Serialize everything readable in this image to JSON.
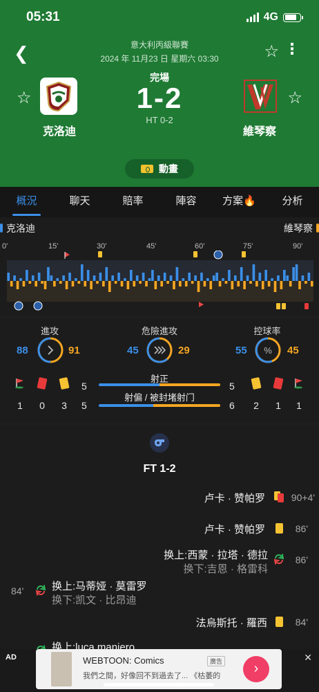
{
  "status_bar": {
    "time": "05:31",
    "network": "4G"
  },
  "match": {
    "league": "意大利丙級聯賽",
    "datetime": "2024 年 11月23 日 星期六 03:30",
    "status": "完場",
    "score": "1-2",
    "halftime": "HT 0-2",
    "home": {
      "name": "克洛迪"
    },
    "away": {
      "name": "維琴察"
    },
    "animation_label": "動畫"
  },
  "tabs": [
    {
      "label": "概況",
      "active": true
    },
    {
      "label": "聊天"
    },
    {
      "label": "賠率"
    },
    {
      "label": "陣容"
    },
    {
      "label": "方案🔥"
    },
    {
      "label": "分析"
    }
  ],
  "team_row": {
    "home": "克洛迪",
    "away": "維琴察"
  },
  "momentum": {
    "minutes": [
      "0'",
      "15'",
      "30'",
      "45'",
      "60'",
      "75'",
      "90'"
    ],
    "home_color": "#3b8fe8",
    "away_color": "#f5a623",
    "values": [
      3,
      -2,
      2,
      -3,
      1,
      -2,
      4,
      -1,
      2,
      -2,
      3,
      -1,
      -3,
      5,
      2,
      -2,
      1,
      -1,
      2,
      -3,
      3,
      -2,
      1,
      -1,
      6,
      -2,
      4,
      -3,
      2,
      -1,
      3,
      -2,
      5,
      -4,
      2,
      -1,
      3,
      -2,
      1,
      -3,
      4,
      -2,
      2,
      -1,
      3,
      -2,
      1,
      4,
      -3,
      2,
      -2,
      3,
      -1,
      2,
      -3,
      5,
      -2,
      1,
      -2,
      3,
      -1,
      2,
      -4,
      3,
      -2,
      1,
      -3,
      2,
      3,
      -2,
      1,
      -1,
      4,
      -3,
      2,
      -2,
      5,
      -3,
      2,
      -1,
      6,
      -2,
      3,
      -3,
      4,
      -2,
      1,
      -4,
      2,
      -3,
      4,
      2,
      -2,
      5,
      6,
      -3,
      2,
      -1,
      3,
      -2
    ]
  },
  "stats": {
    "attack": {
      "label": "進攻",
      "home": "88",
      "away": "91"
    },
    "dangerous": {
      "label": "危險進攻",
      "home": "45",
      "away": "29"
    },
    "possession": {
      "label": "控球率",
      "home": "55",
      "away": "45"
    },
    "home_counts": {
      "corners": "1",
      "red": "0",
      "yellow": "3",
      "on_target": "5",
      "off_target": "5"
    },
    "away_counts": {
      "corners": "1",
      "red": "1",
      "yellow": "2",
      "on_target": "5",
      "off_target": "6"
    },
    "on_target_label": "射正",
    "off_target_label": "射偏 / 被封堵射门"
  },
  "events": {
    "ft": "FT 1-2",
    "list": [
      {
        "name": "卢卡 · 赞帕罗",
        "minute": "90+4'"
      },
      {
        "name": "卢卡 · 赞帕罗",
        "minute": "86'"
      },
      {
        "in": "换上:西蒙 · 拉塔 · 德拉",
        "out": "换下:吉恩 · 格雷科",
        "minute": "86'"
      },
      {
        "in": "换上:马蒂娅 · 莫雷罗",
        "out": "换下:凯文 · 比昂迪",
        "minute": "84'"
      },
      {
        "name": "法烏斯托 · 羅西",
        "minute": "84'"
      },
      {
        "in": "换上:luca maniero",
        "minute": ""
      }
    ]
  },
  "ad": {
    "label": "AD",
    "title": "WEBTOON: Comics",
    "tag": "廣告",
    "desc": "我們之間，好像回不到過去了... 《枯萎的..."
  }
}
